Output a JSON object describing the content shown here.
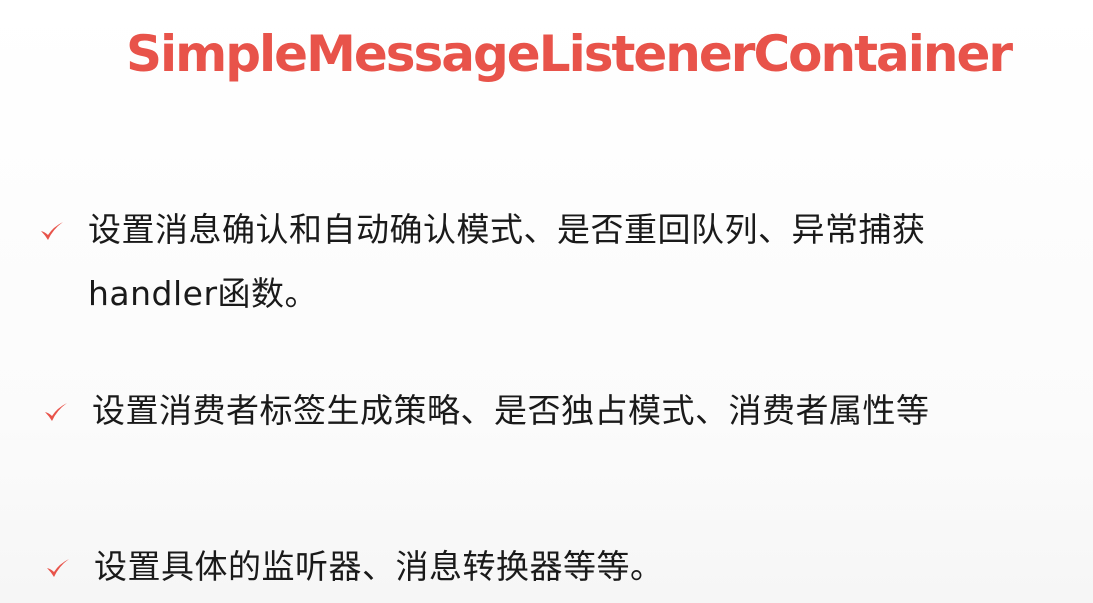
{
  "slide": {
    "title": "SimpleMessageListenerContainer",
    "accent_color": "#e8534a",
    "bullet_icon": "checkmark-icon",
    "bullets": [
      {
        "text": "设置消息确认和自动确认模式、是否重回队列、异常捕获handler函数。"
      },
      {
        "text": "设置消费者标签生成策略、是否独占模式、消费者属性等"
      },
      {
        "text": "设置具体的监听器、消息转换器等等。"
      }
    ]
  }
}
